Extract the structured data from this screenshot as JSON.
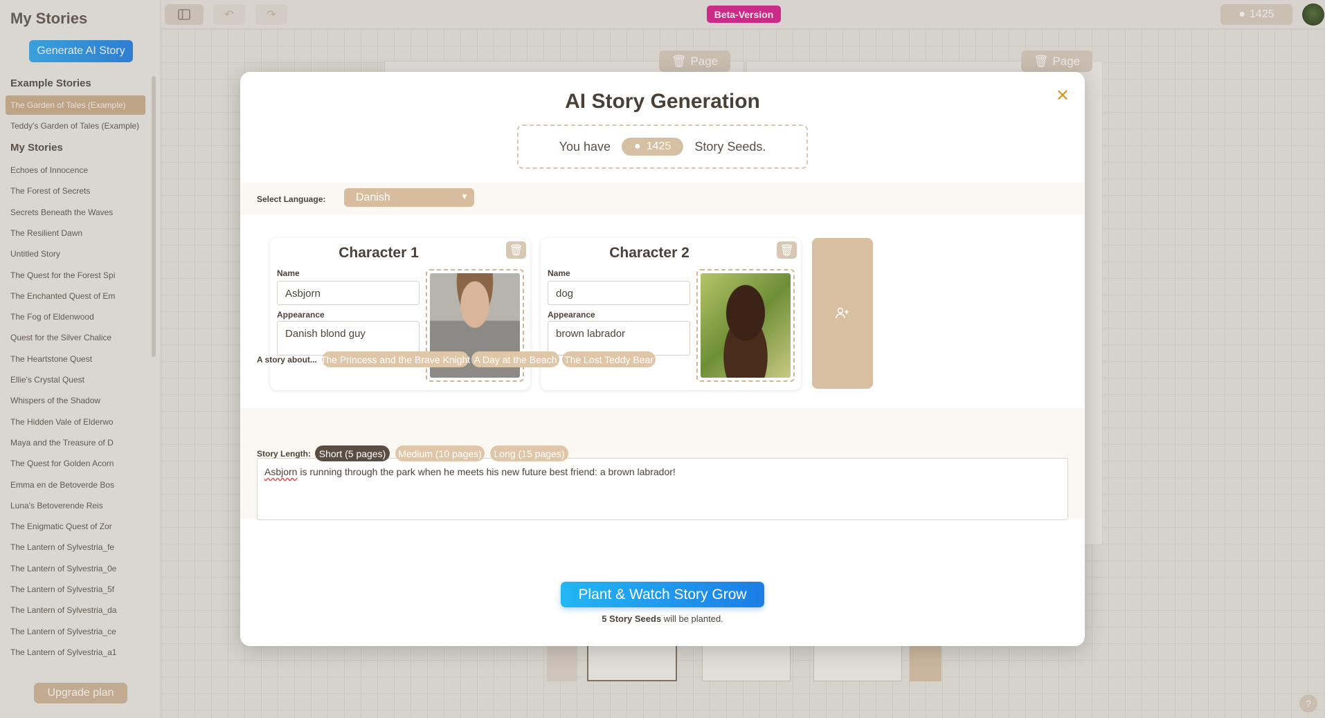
{
  "sidebar": {
    "title": "My Stories",
    "generate_label": "Generate AI Story",
    "example_heading": "Example Stories",
    "examples": [
      "The Garden of Tales (Example)",
      "Teddy's Garden of Tales (Example)"
    ],
    "stories_heading": "My Stories",
    "stories": [
      "Echoes of Innocence",
      "The Forest of Secrets",
      "Secrets Beneath the Waves",
      "The Resilient Dawn",
      "Untitled Story",
      "The Quest for the Forest Spi",
      "The Enchanted Quest of Em",
      "The Fog of Eldenwood",
      "Quest for the Silver Chalice",
      "The Heartstone Quest",
      "Ellie's Crystal Quest",
      "Whispers of the Shadow",
      "The Hidden Vale of Elderwo",
      "Maya and the Treasure of D",
      "The Quest for Golden Acorn",
      "Emma en de Betoverde Bos",
      "Luna's Betoverende Reis",
      "The Enigmatic Quest of Zor",
      "The Lantern of Sylvestria_fe",
      "The Lantern of Sylvestria_0e",
      "The Lantern of Sylvestria_5f",
      "The Lantern of Sylvestria_da",
      "The Lantern of Sylvestria_ce",
      "The Lantern of Sylvestria_a1"
    ],
    "upgrade_label": "Upgrade plan"
  },
  "topbar": {
    "beta_label": "Beta-Version",
    "seeds_count": "1425"
  },
  "canvas": {
    "page_button_label": "Page"
  },
  "modal": {
    "title": "AI Story Generation",
    "close_glyph": "✕",
    "seeds_prefix": "You have",
    "seeds_count": "1425",
    "seeds_suffix": "Story Seeds.",
    "language_label": "Select Language:",
    "language_value": "Danish",
    "characters": [
      {
        "title": "Character 1",
        "name_label": "Name",
        "name_value": "Asbjorn",
        "appearance_label": "Appearance",
        "appearance_value": "Danish blond guy"
      },
      {
        "title": "Character 2",
        "name_label": "Name",
        "name_value": "dog",
        "appearance_label": "Appearance",
        "appearance_value": "brown labrador"
      }
    ],
    "story_label": "A story about...",
    "suggestions": [
      "The Princess and the Brave Knight",
      "A Day at the Beach",
      "The Lost Teddy Bear"
    ],
    "story_first_word": "Asbjorn",
    "story_rest": " is running through the park when he meets his new future best friend: a brown labrador!",
    "length_label": "Story Length:",
    "lengths": [
      "Short (5 pages)",
      "Medium (10 pages)",
      "Long (15 pages)"
    ],
    "selected_length": "Short (5 pages)",
    "plant_label": "Plant & Watch Story Grow",
    "plant_note_bold": "5 Story Seeds",
    "plant_note_rest": " will be planted."
  },
  "colors": {
    "accent_blue": "#1c7de6",
    "beta_pink": "#d8198c",
    "tan": "#d7bd9e",
    "dark_chip": "#5a4d41"
  }
}
